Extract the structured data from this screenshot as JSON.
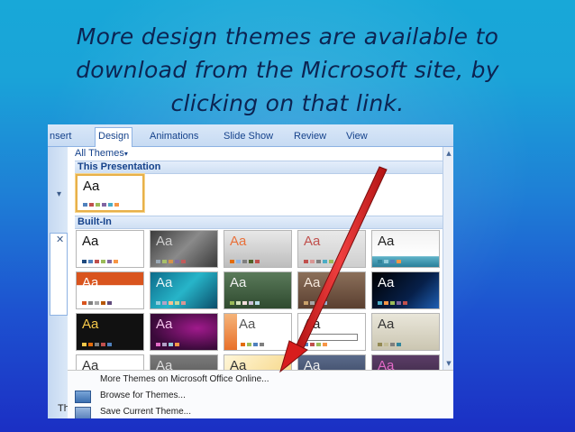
{
  "slide": {
    "title": "More design themes are available to download from the Microsoft site, by clicking on that link."
  },
  "ribbon": {
    "tabs": [
      "nsert",
      "Design",
      "Animations",
      "Slide Show",
      "Review",
      "View"
    ],
    "active_tab": "Design"
  },
  "gallery": {
    "dropdown_label": "All Themes",
    "section_this_presentation": "This Presentation",
    "section_built_in": "Built-In",
    "thumb_text": "Aa"
  },
  "leftstrip": {
    "label": "Th"
  },
  "menu": {
    "items": [
      "More Themes on Microsoft Office Online...",
      "Browse for Themes...",
      "Save Current Theme..."
    ]
  },
  "colors": {
    "title_text": "#0c2452",
    "arrow": "#e21d1d",
    "ribbon_accent": "#15428b"
  },
  "icons": [
    "chevron-down-icon",
    "close-icon",
    "scroll-up-icon",
    "scroll-down-icon",
    "office-online-icon",
    "folder-browse-icon",
    "save-theme-icon"
  ]
}
